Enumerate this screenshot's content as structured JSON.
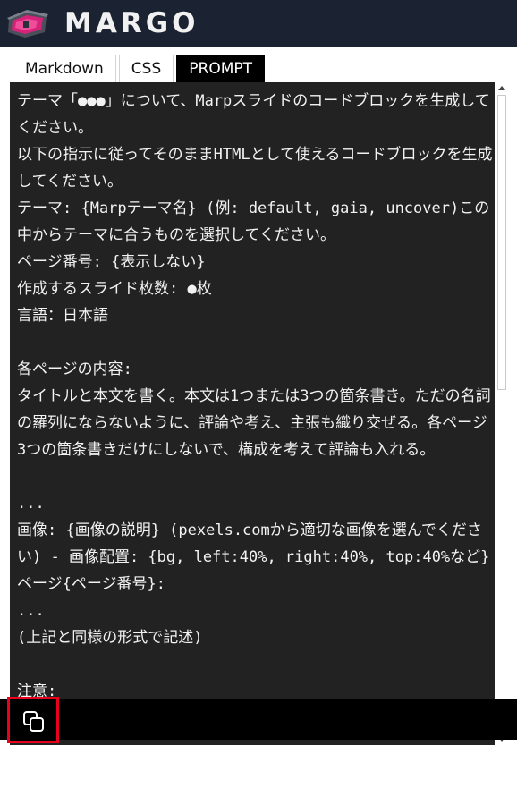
{
  "app": {
    "brand": "MARGO",
    "logo_icon": "chest-icon",
    "colors": {
      "background": "#1b2332",
      "accent": "#e8001c",
      "editor": "#222222"
    }
  },
  "tabs": [
    {
      "label": "Markdown",
      "active": false
    },
    {
      "label": "CSS",
      "active": false
    },
    {
      "label": "PROMPT",
      "active": true
    }
  ],
  "editor": {
    "content": "テーマ「●●●」について、Marpスライドのコードブロックを生成してください。\n以下の指示に従ってそのままHTMLとして使えるコードブロックを生成してください。\nテーマ: {Marpテーマ名} (例: default, gaia, uncover)この中からテーマに合うものを選択してください。\nページ番号: {表示しない}\n作成するスライド枚数: ●枚\n言語：日本語\n\n各ページの内容:\nタイトルと本文を書く。本文は1つまたは3つの箇条書き。ただの名詞の羅列にならないように、評論や考え、主張も織り交ぜる。各ページ3つの箇条書きだけにしないで、構成を考えて評論も入れる。\n\n...\n画像: {画像の説明} (pexels.comから適切な画像を選んでください) - 画像配置: {bg, left:40%, right:40%, top:40%など}\nページ{ページ番号}:\n...\n(上記と同様の形式で記述)\n\n注意:"
  },
  "toolbar": {
    "copy_icon": "copy-icon"
  }
}
